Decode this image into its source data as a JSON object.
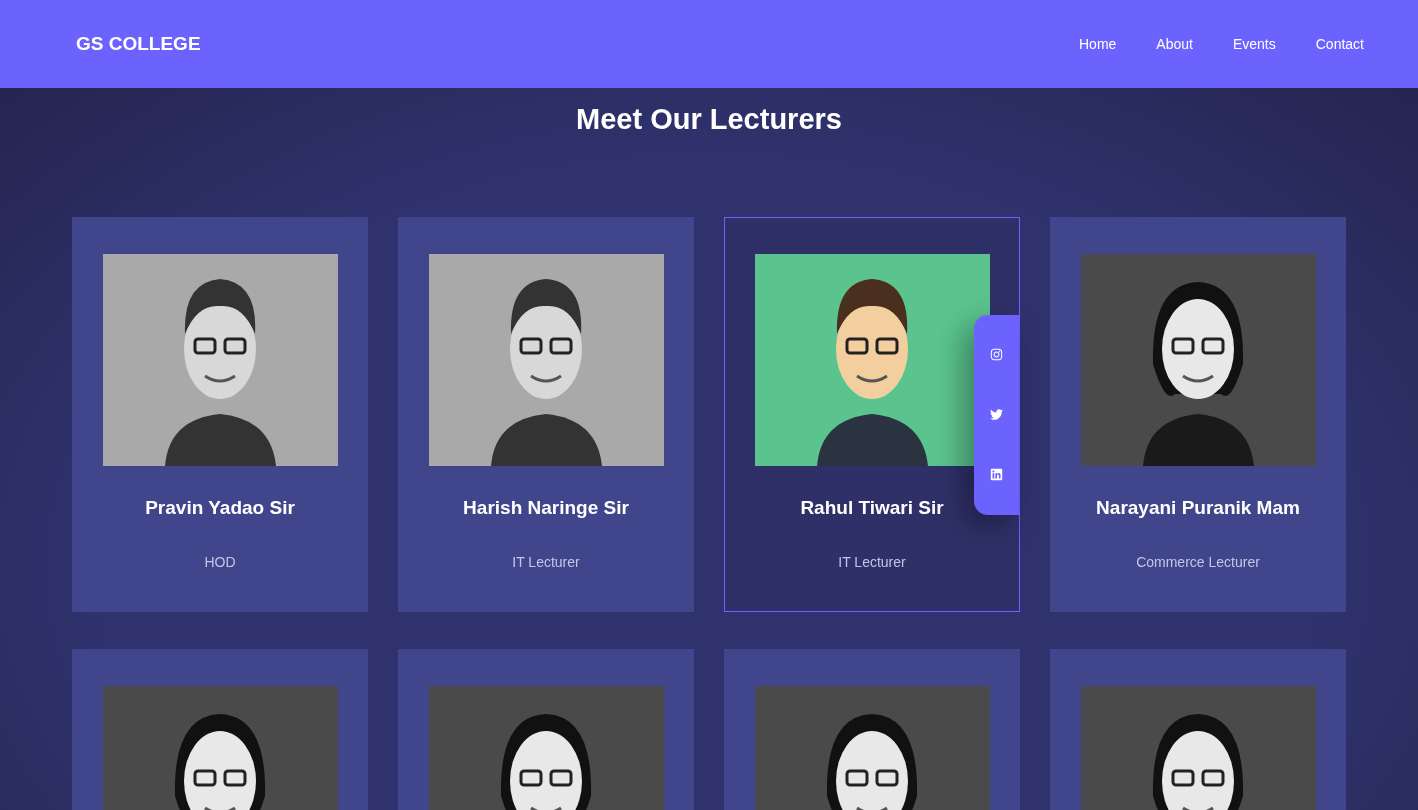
{
  "navbar": {
    "brand": "GS COLLEGE",
    "links": [
      "Home",
      "About",
      "Events",
      "Contact"
    ]
  },
  "heading": "Meet Our Lecturers",
  "lecturers": [
    {
      "kind": "male",
      "name": "Pravin Yadao Sir",
      "role": "HOD",
      "selected": false
    },
    {
      "kind": "male",
      "name": "Harish Naringe Sir",
      "role": "IT Lecturer",
      "selected": false
    },
    {
      "kind": "male",
      "name": "Rahul Tiwari Sir",
      "role": "IT Lecturer",
      "selected": true
    },
    {
      "kind": "female",
      "name": "Narayani Puranik Mam",
      "role": "Commerce Lecturer",
      "selected": false
    },
    {
      "kind": "female",
      "selected": false
    },
    {
      "kind": "female",
      "selected": false
    },
    {
      "kind": "female",
      "selected": false
    },
    {
      "kind": "female",
      "selected": false
    }
  ]
}
